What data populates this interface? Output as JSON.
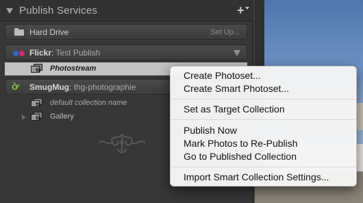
{
  "panel": {
    "title": "Publish Services",
    "add_icon": "plus-icon"
  },
  "services": [
    {
      "name": "Hard Drive",
      "action": "Set Up...",
      "icon": "folder-icon"
    },
    {
      "name": "Flickr",
      "separator": ":",
      "account": "Test Publish",
      "icon": "flickr-icon"
    },
    {
      "name": "SmugMug",
      "separator": ":",
      "account": "thg-photographie",
      "icon": "smugmug-icon"
    }
  ],
  "collections": {
    "flickr_photostream": "Photostream",
    "smugmug_default": "default collection name",
    "smugmug_gallery": "Gallery"
  },
  "context_menu": {
    "items": [
      "Create Photoset...",
      "Create Smart Photoset...",
      "Set as Target Collection",
      "Publish Now",
      "Mark Photos to Re-Publish",
      "Go to Published Collection",
      "Import Smart Collection Settings..."
    ]
  },
  "colors": {
    "panel_bg": "#373737",
    "selected_row": "#c2c2c2",
    "flickr_blue": "#2e67d1",
    "flickr_pink": "#e0227c",
    "smugmug_green": "#85c340",
    "menu_bg": "#f4f4f4"
  }
}
